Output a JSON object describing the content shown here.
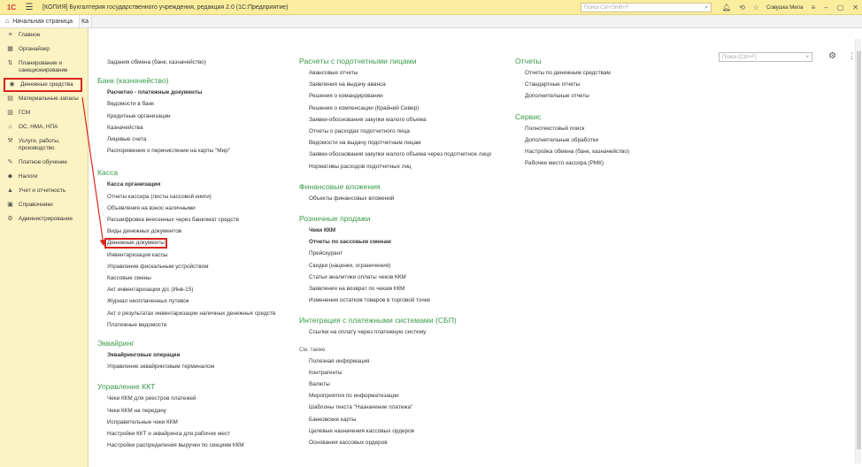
{
  "titlebar": {
    "logo": "1С",
    "title": "[КОПИЯ] Бухгалтерия государственного учреждения, редакция 2.0  (1С:Предприятие)",
    "search_placeholder": "Поиск Ctrl+Shift+F",
    "user": "Совушка Мила"
  },
  "tabs": {
    "home": "Начальная страница",
    "second": "Ка"
  },
  "sidebar": {
    "items": [
      {
        "label": "Главное",
        "icon": "≡"
      },
      {
        "label": "Органайзер",
        "icon": "▦"
      },
      {
        "label": "Планирование и санкционирование",
        "icon": "⇅"
      },
      {
        "label": "Денежные средства",
        "icon": "◉"
      },
      {
        "label": "Материальные запасы",
        "icon": "▤"
      },
      {
        "label": "ГСМ",
        "icon": "▥"
      },
      {
        "label": "ОС, НМА, НПА",
        "icon": "⌂"
      },
      {
        "label": "Услуги, работы, производство",
        "icon": "⚒"
      },
      {
        "label": "Платное обучение",
        "icon": "✎"
      },
      {
        "label": "Налоги",
        "icon": "◆"
      },
      {
        "label": "Учет и отчетность",
        "icon": "▲"
      },
      {
        "label": "Справочники",
        "icon": "▣"
      },
      {
        "label": "Администрирование",
        "icon": "⚙"
      }
    ]
  },
  "main": {
    "search_placeholder": "Поиск (Ctrl+F)",
    "col1": {
      "top_link": "Задания обмена (банк, казначейство)",
      "bank_title": "Банк (казначейство)",
      "bank_items": [
        {
          "label": "Расчетно - платежные документы",
          "bold": true
        },
        {
          "label": "Ведомости в банк",
          "bold": false
        },
        {
          "label": "Кредитные организации",
          "bold": false
        },
        {
          "label": "Казначейства",
          "bold": false
        },
        {
          "label": "Лицевые счета",
          "bold": false
        },
        {
          "label": "Распоряжения о перечислении на карты \"Мир\"",
          "bold": false
        }
      ],
      "kassa_title": "Касса",
      "kassa_items": [
        {
          "label": "Касса организации",
          "bold": true
        },
        {
          "label": "Отчеты кассира (листы кассовой книги)",
          "bold": false
        },
        {
          "label": "Объявления на взнос наличными",
          "bold": false
        },
        {
          "label": "Расшифровка внесенных через банкомат средств",
          "bold": false
        },
        {
          "label": "Виды денежных документов",
          "bold": false
        },
        {
          "label": "Денежные документы",
          "bold": false
        },
        {
          "label": "Инвентаризация кассы",
          "bold": false
        },
        {
          "label": "Управление фискальным устройством",
          "bold": false
        },
        {
          "label": "Кассовые смены",
          "bold": false
        },
        {
          "label": "Акт инвентаризации д/с (Инв-15)",
          "bold": false
        },
        {
          "label": "Журнал неоплаченных путевок",
          "bold": false
        },
        {
          "label": "Акт о результатах инвентаризации наличных денежных средств",
          "bold": false
        },
        {
          "label": "Платежные ведомости",
          "bold": false
        }
      ],
      "acq_title": "Эквайринг",
      "acq_items": [
        {
          "label": "Эквайринговые операции",
          "bold": true
        },
        {
          "label": "Управление эквайринговым терминалом",
          "bold": false
        }
      ],
      "kkt_title": "Управление ККТ",
      "kkt_items": [
        {
          "label": "Чеки ККМ для реестров платежей",
          "bold": false
        },
        {
          "label": "Чеки ККМ на передачу",
          "bold": false
        },
        {
          "label": "Исправительные чеки ККМ",
          "bold": false
        },
        {
          "label": "Настройки ККТ и эквайринга для рабочих мест",
          "bold": false
        },
        {
          "label": "Настройки распределения выручки по секциям ККМ",
          "bold": false
        }
      ]
    },
    "col2": {
      "acc_title": "Расчеты с подотчетными лицами",
      "acc_items": [
        "Авансовые отчеты",
        "Заявления на выдачу аванса",
        "Решения о командировании",
        "Решения о компенсации (Крайний Север)",
        "Заявки-обоснования закупки малого объема",
        "Отчеты о расходах подотчетного лица",
        "Ведомости на выдачу подотчетным лицам",
        "Заявки-обоснования закупки малого объема через подотчетное лицо",
        "Нормативы расходов подотчетных лиц"
      ],
      "fin_title": "Финансовые вложения",
      "fin_items": [
        "Объекты финансовых вложений"
      ],
      "retail_title": "Розничные продажи",
      "retail_items": [
        {
          "label": "Чеки ККМ",
          "bold": true
        },
        {
          "label": "Отчеты по кассовым сменам",
          "bold": true
        },
        {
          "label": "Прейскурант",
          "bold": false
        },
        {
          "label": "Скидки (наценки, ограничения)",
          "bold": false
        },
        {
          "label": "Статьи аналитики оплаты чеков ККМ",
          "bold": false
        },
        {
          "label": "Заявления на возврат по чекам ККМ",
          "bold": false
        },
        {
          "label": "Изменения остатков товаров в торговой точке",
          "bold": false
        }
      ],
      "sbp_title": "Интеграция с платежными системами (СБП)",
      "sbp_items": [
        "Ссылки на оплату через платежную систему"
      ],
      "see_also": "См. также",
      "see_items": [
        "Полезная информация",
        "Контрагенты",
        "Валюты",
        "Мероприятия по информатизации",
        "Шаблоны текста \"Назначение платежа\"",
        "Банковские карты",
        "Целевые назначения кассовых ордеров",
        "Основания кассовых ордеров"
      ]
    },
    "col3": {
      "rep_title": "Отчеты",
      "rep_items": [
        "Отчеты по денежным средствам",
        "Стандартные отчеты",
        "Дополнительные отчеты"
      ],
      "svc_title": "Сервис",
      "svc_items": [
        "Полнотекстовый поиск",
        "Дополнительные обработки",
        "Настройка обмена (банк, казначейство)",
        "Рабочее место кассира (РМК)"
      ]
    }
  },
  "colors": {
    "section_title": "#3a9a4a",
    "sidebar_bg": "#fbf3c4",
    "titlebar_bg": "#fbed9e",
    "highlight": "#d9261c"
  }
}
